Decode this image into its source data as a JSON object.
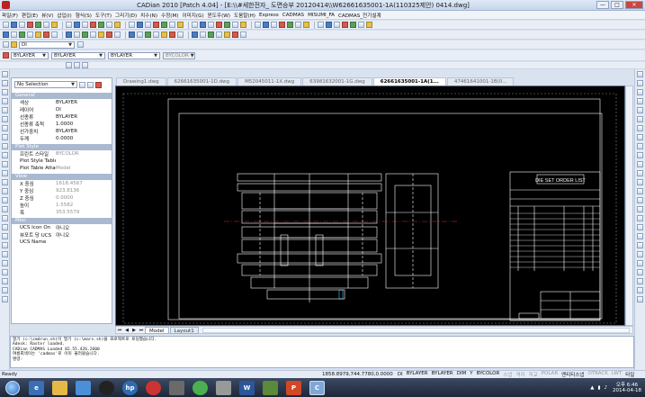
{
  "window": {
    "title": "CADian 2010 [Patch 4.04] - [E:\\\\#세한전자_ 도면승부 20120414\\\\W62661635001-1A(110325제안) 0414.dwg]",
    "min_label": "—",
    "max_label": "□",
    "close_label": "✕"
  },
  "menu": {
    "items": [
      "파일(F)",
      "편집(E)",
      "뷰(V)",
      "삽입(I)",
      "형식(S)",
      "도구(T)",
      "그리기(D)",
      "치수(N)",
      "수정(M)",
      "이미지(G)",
      "윈도우(W)",
      "도움말(H)",
      "Express",
      "CADMAS",
      "MISUMI_FA",
      "CADMAS_전기설계"
    ]
  },
  "layer_bar": {
    "layer_value": "DI"
  },
  "props_bar": {
    "color": "BYLAYER",
    "linetype": "BYLAYER",
    "lineweight": "BYLAYER",
    "plotstyle": "BYCOLOR"
  },
  "properties": {
    "selection": "No Selection",
    "sections": [
      {
        "title": "General",
        "rows": [
          {
            "k": "색상",
            "v": "BYLAYER",
            "dim": false
          },
          {
            "k": "레이어",
            "v": "DI",
            "dim": false
          },
          {
            "k": "선종류",
            "v": "BYLAYER",
            "dim": false
          },
          {
            "k": "선종류 축척",
            "v": "1.0000",
            "dim": false
          },
          {
            "k": "선가중치",
            "v": "BYLAYER",
            "dim": false
          },
          {
            "k": "두께",
            "v": "0.0000",
            "dim": false
          }
        ]
      },
      {
        "title": "Plot Style",
        "rows": [
          {
            "k": "프린트 스타일",
            "v": "BYCOLOR",
            "dim": true
          },
          {
            "k": "Plot Style Table",
            "v": "",
            "dim": false
          },
          {
            "k": "Plot Table Attac",
            "v": "Model",
            "dim": true
          }
        ]
      },
      {
        "title": "View",
        "rows": [
          {
            "k": "X 중심",
            "v": "1618.4567",
            "dim": true
          },
          {
            "k": "Y 중심",
            "v": "923.8136",
            "dim": true
          },
          {
            "k": "Z 중심",
            "v": "0.0000",
            "dim": true
          },
          {
            "k": "높이",
            "v": "1.5582",
            "dim": true
          },
          {
            "k": "폭",
            "v": "353.5579",
            "dim": true
          }
        ]
      },
      {
        "title": "Misc",
        "rows": [
          {
            "k": "UCS Icon On",
            "v": "아니오",
            "dim": false
          },
          {
            "k": "뷰포트 당 UCS",
            "v": "아니오",
            "dim": false
          },
          {
            "k": "UCS Name",
            "v": "",
            "dim": false
          }
        ]
      }
    ]
  },
  "doc_tabs": [
    {
      "label": "Drawing1.dwg",
      "active": false
    },
    {
      "label": "62661635001-1D.dwg",
      "active": false
    },
    {
      "label": "M52045011-1X.dwg",
      "active": false
    },
    {
      "label": "63981632001-1G.dwg",
      "active": false
    },
    {
      "label": "62661635001-1A(1...",
      "active": true
    },
    {
      "label": "47461641001-1B(0...",
      "active": false
    }
  ],
  "drawing": {
    "table_title": "DIE SET ORDER LIST"
  },
  "layout_tabs": {
    "model": "Model",
    "layout": "Layout1"
  },
  "command": {
    "lines": [
      "열기 (c:\\cmdrun.sh)이 열기 (c:\\mars.sh)을 프로젝트로 로딩했습니다.",
      "Adesk: Raster loaded.",
      "CADian CADMAS Loaded 82.55.426.2600",
      "여름회색이는 'cadmas'로 이미 불러왔습니다.",
      "명령:"
    ]
  },
  "status": {
    "ready": "Ready",
    "coords": "1858.8979,744.7780,0.0000",
    "layer": "DI",
    "items": [
      {
        "t": "BYLAYER",
        "off": false
      },
      {
        "t": "BYLAYER",
        "off": false
      },
      {
        "t": "DIM",
        "off": false
      },
      {
        "t": "Y",
        "off": false
      },
      {
        "t": "BYCOLOR",
        "off": false
      },
      {
        "t": "스냅",
        "off": true
      },
      {
        "t": "격자",
        "off": true
      },
      {
        "t": "직교",
        "off": true
      },
      {
        "t": "POLAR",
        "off": true
      },
      {
        "t": "엔티티스냅",
        "off": false
      },
      {
        "t": "OTRACK",
        "off": true
      },
      {
        "t": "LWT",
        "off": true
      },
      {
        "t": "타일",
        "off": false
      }
    ]
  },
  "taskbar": {
    "time": "오후 6:46",
    "date": "2014-04-18"
  }
}
